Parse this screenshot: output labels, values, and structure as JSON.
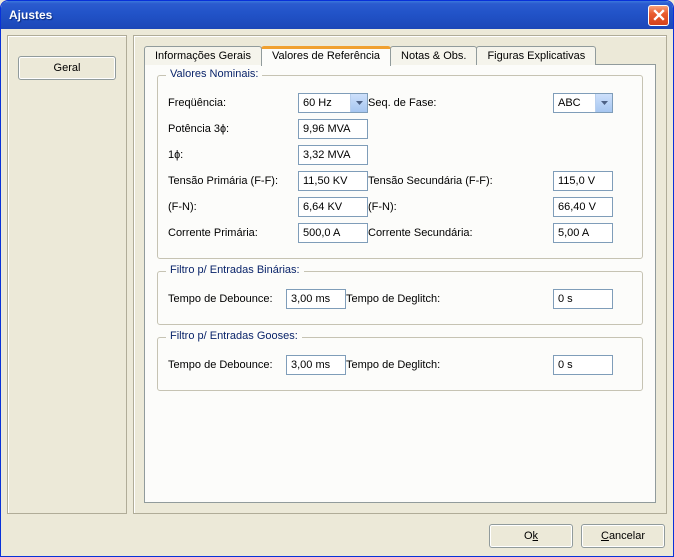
{
  "window": {
    "title": "Ajustes"
  },
  "sidebar": {
    "geral": "Geral"
  },
  "tabs": {
    "info": "Informações Gerais",
    "ref": "Valores de Referência",
    "notas": "Notas & Obs.",
    "fig": "Figuras Explicativas",
    "selected": 1
  },
  "group_nominal": {
    "legend": "Valores Nominais:",
    "freq_label": "Freqüência:",
    "freq_value": "60 Hz",
    "seqfase_label": "Seq. de Fase:",
    "seqfase_value": "ABC",
    "pot3_label": "Potência 3ɸ:",
    "pot3_value": "9,96 MVA",
    "pot1_label": "1ɸ:",
    "pot1_value": "3,32 MVA",
    "tpri_ff_label": "Tensão Primária (F-F):",
    "tpri_ff_value": "11,50 KV",
    "tsec_ff_label": "Tensão Secundária (F-F):",
    "tsec_ff_value": "115,0 V",
    "fn1_label": "(F-N):",
    "fn1_value": "6,64 KV",
    "fn2_label": "(F-N):",
    "fn2_value": "66,40 V",
    "ipri_label": "Corrente Primária:",
    "ipri_value": "500,0 A",
    "isec_label": "Corrente Secundária:",
    "isec_value": "5,00 A"
  },
  "group_bin": {
    "legend": "Filtro p/ Entradas Binárias:",
    "debounce_label": "Tempo de Debounce:",
    "debounce_value": "3,00 ms",
    "deglitch_label": "Tempo de Deglitch:",
    "deglitch_value": "0 s"
  },
  "group_goose": {
    "legend": "Filtro p/ Entradas Gooses:",
    "debounce_label": "Tempo de Debounce:",
    "debounce_value": "3,00 ms",
    "deglitch_label": "Tempo de Deglitch:",
    "deglitch_value": "0 s"
  },
  "buttons": {
    "ok_pre": "O",
    "ok_u": "k",
    "cancel_u": "C",
    "cancel_post": "ancelar"
  }
}
